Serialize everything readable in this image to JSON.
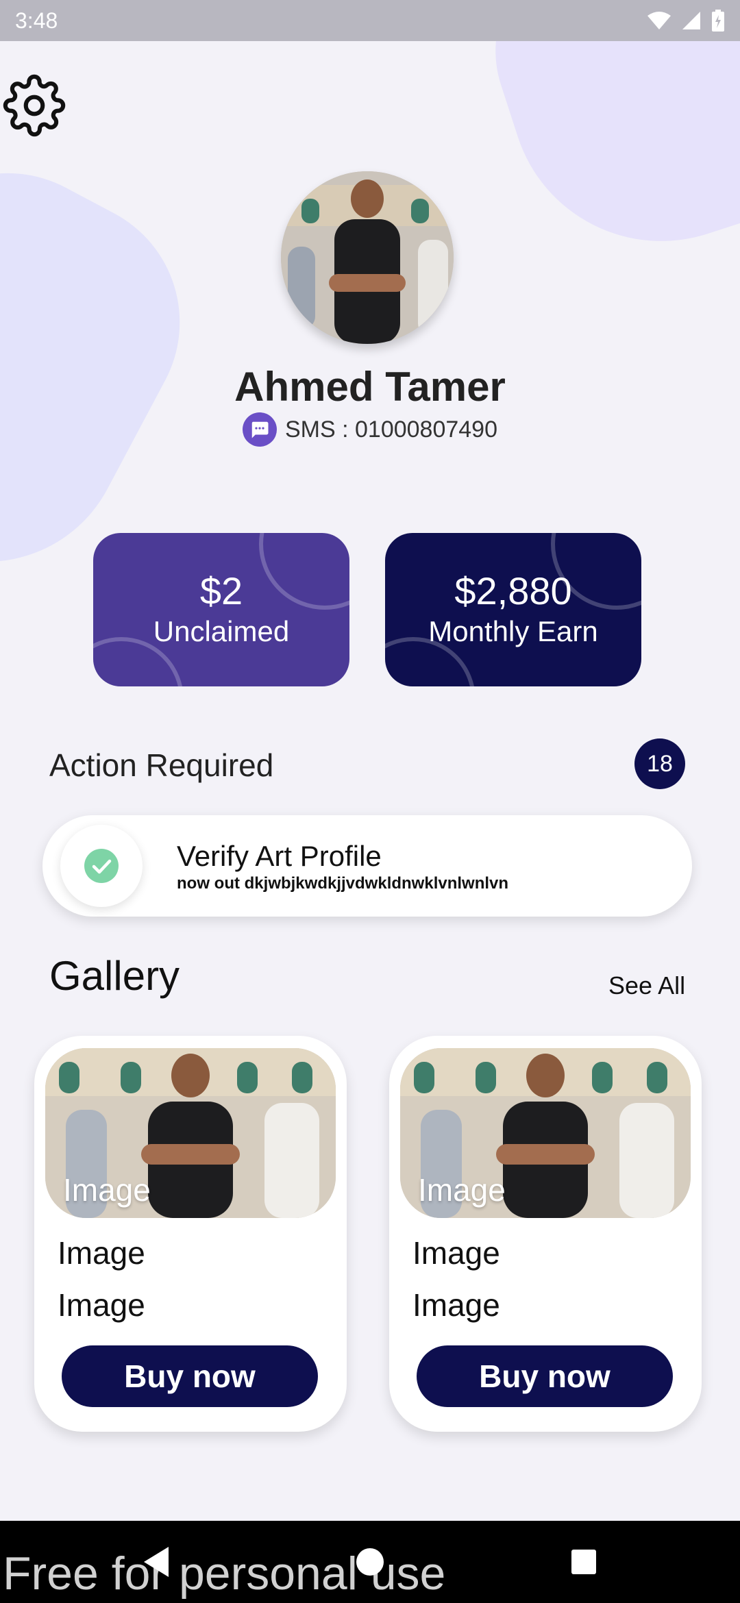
{
  "status_bar": {
    "time": "3:48",
    "icons": [
      "wifi-icon",
      "signal-icon",
      "battery-icon"
    ]
  },
  "profile": {
    "name": "Ahmed Tamer",
    "sms_label": "SMS : 01000807490"
  },
  "stats": [
    {
      "value": "$2",
      "label": "Unclaimed"
    },
    {
      "value": "$2,880",
      "label": "Monthly Earn"
    }
  ],
  "actions": {
    "title": "Action Required",
    "count": "18",
    "item": {
      "title": "Verify Art Profile",
      "subtitle": "now out dkjwbjkwdkjjvdwkldnwklvnlwnlvn"
    }
  },
  "gallery": {
    "title": "Gallery",
    "see_all": "See All",
    "cards": [
      {
        "image_label": "Image",
        "line1": "Image",
        "line2": "Image",
        "button": "Buy now"
      },
      {
        "image_label": "Image",
        "line1": "Image",
        "line2": "Image",
        "button": "Buy now"
      }
    ]
  },
  "watermark": "Free for personal use",
  "colors": {
    "accent_purple": "#4b3a96",
    "navy": "#0e0f4f",
    "check_green": "#7ed4a6",
    "background": "#f3f2f8"
  }
}
